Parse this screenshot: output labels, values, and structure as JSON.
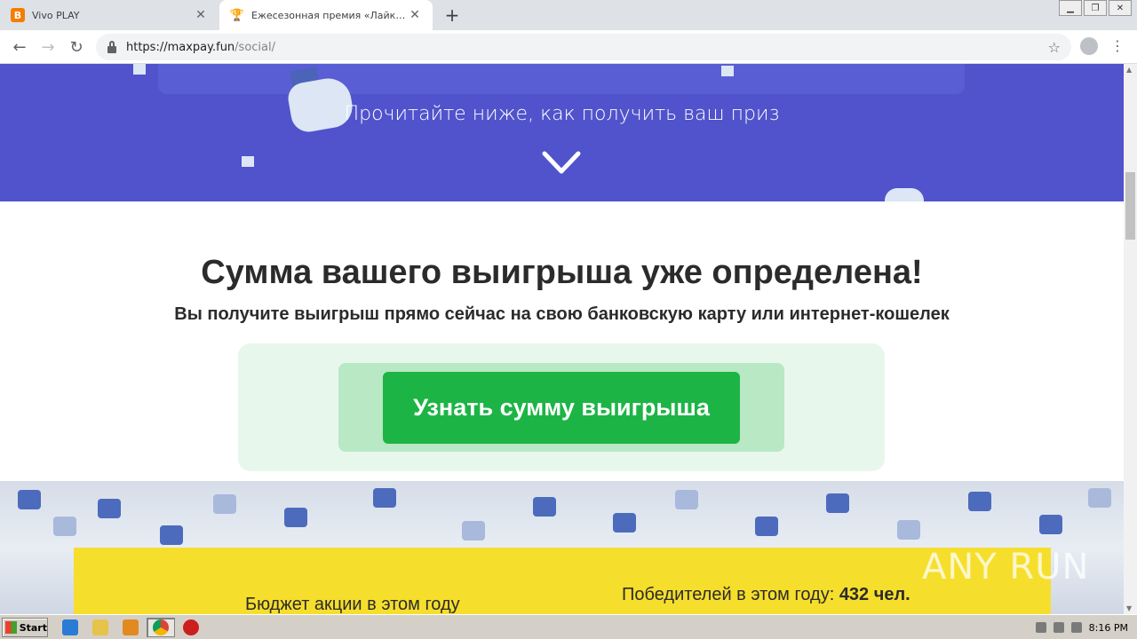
{
  "browser": {
    "tabs": [
      {
        "title": "Vivo PLAY",
        "favicon": "blogger-icon"
      },
      {
        "title": "Ежесезонная премия «Лайк года»",
        "favicon": "trophy-icon"
      }
    ],
    "url_host": "https://maxpay.fun",
    "url_path": "/social/"
  },
  "hero": {
    "text": "Прочитайте ниже, как получить ваш приз",
    "bg_color": "#5053cb"
  },
  "main": {
    "title": "Сумма вашего выигрыша уже определена!",
    "subtitle": "Вы получите выигрыш прямо сейчас на свою банковскую карту или интернет-кошелек",
    "cta_label": "Узнать сумму выигрыша",
    "cta_color": "#1db446"
  },
  "stats": {
    "budget_label": "Бюджет акции в этом году",
    "winners_label": "Победителей в этом году:",
    "winners_value": "432 чел."
  },
  "watermark": "ANY RUN",
  "taskbar": {
    "start_label": "Start",
    "clock": "8:16 PM"
  }
}
